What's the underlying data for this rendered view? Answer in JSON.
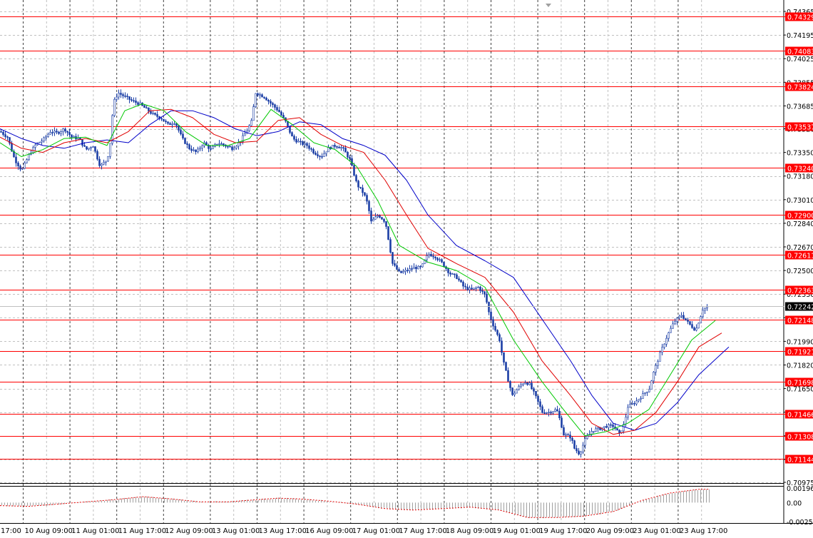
{
  "colors": {
    "background": "#ffffff",
    "grid": "#c0c0c0",
    "vgrid": "#000000",
    "level_line": "#ff0000",
    "level_box": "#ff0000",
    "level_text": "#ffffff",
    "candles": "#1c3fa6",
    "ma_fast": "#00c800",
    "ma_mid": "#e00000",
    "ma_slow": "#0000c8",
    "osc_bars": "#a0a0a0",
    "osc_line": "#e00000",
    "current_tag": "#000000",
    "axis_text": "#000000"
  },
  "chart_data": [
    {
      "type": "candlestick",
      "symbol_pair_precision": 5,
      "ylim": [
        0.70975,
        0.74365
      ],
      "y_ticks": [
        "0.74365",
        "0.74195",
        "0.74025",
        "0.73855",
        "0.73685",
        "0.73520",
        "0.73350",
        "0.73180",
        "0.73010",
        "0.72840",
        "0.72670",
        "0.72500",
        "0.72330",
        "0.72160",
        "0.71990",
        "0.71820",
        "0.71650",
        "0.71480",
        "0.71310",
        "0.71140",
        "0.70975"
      ],
      "x_labels": [
        "17:00",
        "10 Aug 09:00",
        "11 Aug 01:00",
        "11 Aug 17:00",
        "12 Aug 09:00",
        "13 Aug 01:00",
        "13 Aug 17:00",
        "16 Aug 09:00",
        "17 Aug 01:00",
        "17 Aug 17:00",
        "18 Aug 09:00",
        "19 Aug 01:00",
        "19 Aug 17:00",
        "20 Aug 09:00",
        "23 Aug 01:00",
        "23 Aug 17:00"
      ],
      "levels": [
        "0.74329",
        "0.74083",
        "0.73824",
        "0.73537",
        "0.73240",
        "0.72900",
        "0.72611",
        "0.72363",
        "0.72148",
        "0.71921",
        "0.71698",
        "0.71466",
        "0.71308",
        "0.71144"
      ],
      "current_price": "0.72242",
      "close_path": [
        [
          0,
          0.735
        ],
        [
          10,
          0.7346
        ],
        [
          20,
          0.733
        ],
        [
          30,
          0.7322
        ],
        [
          40,
          0.7333
        ],
        [
          50,
          0.7341
        ],
        [
          60,
          0.7344
        ],
        [
          70,
          0.735
        ],
        [
          80,
          0.7349
        ],
        [
          90,
          0.7352
        ],
        [
          100,
          0.7346
        ],
        [
          110,
          0.7345
        ],
        [
          120,
          0.7337
        ],
        [
          130,
          0.734
        ],
        [
          140,
          0.7325
        ],
        [
          150,
          0.733
        ],
        [
          155,
          0.7345
        ],
        [
          158,
          0.737
        ],
        [
          165,
          0.7378
        ],
        [
          175,
          0.7375
        ],
        [
          185,
          0.7372
        ],
        [
          195,
          0.737
        ],
        [
          205,
          0.7366
        ],
        [
          215,
          0.7362
        ],
        [
          225,
          0.736
        ],
        [
          235,
          0.7355
        ],
        [
          245,
          0.7357
        ],
        [
          255,
          0.7345
        ],
        [
          265,
          0.7338
        ],
        [
          275,
          0.7335
        ],
        [
          285,
          0.7342
        ],
        [
          295,
          0.7337
        ],
        [
          305,
          0.7342
        ],
        [
          315,
          0.734
        ],
        [
          325,
          0.7338
        ],
        [
          335,
          0.7342
        ],
        [
          345,
          0.735
        ],
        [
          352,
          0.7357
        ],
        [
          358,
          0.7378
        ],
        [
          370,
          0.7375
        ],
        [
          380,
          0.737
        ],
        [
          390,
          0.7365
        ],
        [
          400,
          0.7357
        ],
        [
          410,
          0.7345
        ],
        [
          420,
          0.7342
        ],
        [
          430,
          0.734
        ],
        [
          440,
          0.7335
        ],
        [
          450,
          0.7332
        ],
        [
          460,
          0.7338
        ],
        [
          470,
          0.734
        ],
        [
          480,
          0.7338
        ],
        [
          490,
          0.733
        ],
        [
          500,
          0.7312
        ],
        [
          510,
          0.7305
        ],
        [
          515,
          0.7298
        ],
        [
          520,
          0.7285
        ],
        [
          530,
          0.729
        ],
        [
          540,
          0.7285
        ],
        [
          545,
          0.727
        ],
        [
          550,
          0.7255
        ],
        [
          560,
          0.7248
        ],
        [
          570,
          0.725
        ],
        [
          580,
          0.7252
        ],
        [
          590,
          0.7252
        ],
        [
          600,
          0.7262
        ],
        [
          610,
          0.726
        ],
        [
          620,
          0.7255
        ],
        [
          630,
          0.7248
        ],
        [
          640,
          0.7245
        ],
        [
          650,
          0.7238
        ],
        [
          660,
          0.7236
        ],
        [
          670,
          0.7238
        ],
        [
          680,
          0.7232
        ],
        [
          685,
          0.722
        ],
        [
          690,
          0.7212
        ],
        [
          700,
          0.72
        ],
        [
          705,
          0.7185
        ],
        [
          710,
          0.7175
        ],
        [
          718,
          0.716
        ],
        [
          725,
          0.7165
        ],
        [
          735,
          0.717
        ],
        [
          742,
          0.7168
        ],
        [
          750,
          0.716
        ],
        [
          760,
          0.7148
        ],
        [
          770,
          0.7148
        ],
        [
          780,
          0.715
        ],
        [
          785,
          0.7142
        ],
        [
          790,
          0.7132
        ],
        [
          800,
          0.713
        ],
        [
          805,
          0.7122
        ],
        [
          812,
          0.7118
        ],
        [
          820,
          0.7128
        ],
        [
          830,
          0.7135
        ],
        [
          840,
          0.7136
        ],
        [
          850,
          0.7138
        ],
        [
          860,
          0.7138
        ],
        [
          868,
          0.7132
        ],
        [
          875,
          0.714
        ],
        [
          880,
          0.7152
        ],
        [
          890,
          0.7155
        ],
        [
          900,
          0.716
        ],
        [
          910,
          0.7165
        ],
        [
          915,
          0.7175
        ],
        [
          925,
          0.719
        ],
        [
          935,
          0.7203
        ],
        [
          945,
          0.7213
        ],
        [
          955,
          0.7218
        ],
        [
          965,
          0.7212
        ],
        [
          975,
          0.7207
        ],
        [
          985,
          0.7222
        ],
        [
          993,
          0.7224
        ]
      ],
      "ma_fast_path": [
        [
          0,
          0.7342
        ],
        [
          30,
          0.7332
        ],
        [
          60,
          0.7337
        ],
        [
          90,
          0.7345
        ],
        [
          120,
          0.7346
        ],
        [
          150,
          0.734
        ],
        [
          175,
          0.7365
        ],
        [
          200,
          0.737
        ],
        [
          230,
          0.7365
        ],
        [
          260,
          0.735
        ],
        [
          290,
          0.734
        ],
        [
          320,
          0.734
        ],
        [
          350,
          0.7345
        ],
        [
          380,
          0.7366
        ],
        [
          410,
          0.7355
        ],
        [
          440,
          0.7342
        ],
        [
          470,
          0.7337
        ],
        [
          500,
          0.7325
        ],
        [
          530,
          0.73
        ],
        [
          560,
          0.7268
        ],
        [
          600,
          0.7256
        ],
        [
          640,
          0.725
        ],
        [
          680,
          0.7238
        ],
        [
          720,
          0.72
        ],
        [
          760,
          0.717
        ],
        [
          790,
          0.715
        ],
        [
          820,
          0.7131
        ],
        [
          850,
          0.7134
        ],
        [
          880,
          0.714
        ],
        [
          910,
          0.715
        ],
        [
          940,
          0.7175
        ],
        [
          970,
          0.72
        ],
        [
          1003,
          0.7214
        ]
      ],
      "ma_mid_path": [
        [
          0,
          0.7346
        ],
        [
          30,
          0.7338
        ],
        [
          60,
          0.7335
        ],
        [
          90,
          0.7342
        ],
        [
          120,
          0.7345
        ],
        [
          150,
          0.7342
        ],
        [
          180,
          0.735
        ],
        [
          210,
          0.7365
        ],
        [
          240,
          0.7366
        ],
        [
          270,
          0.736
        ],
        [
          300,
          0.7348
        ],
        [
          330,
          0.7342
        ],
        [
          360,
          0.7343
        ],
        [
          390,
          0.7358
        ],
        [
          420,
          0.736
        ],
        [
          450,
          0.7348
        ],
        [
          480,
          0.734
        ],
        [
          510,
          0.7335
        ],
        [
          540,
          0.7315
        ],
        [
          570,
          0.729
        ],
        [
          600,
          0.7266
        ],
        [
          640,
          0.7255
        ],
        [
          680,
          0.7245
        ],
        [
          720,
          0.722
        ],
        [
          760,
          0.7185
        ],
        [
          800,
          0.716
        ],
        [
          830,
          0.714
        ],
        [
          860,
          0.7132
        ],
        [
          890,
          0.7135
        ],
        [
          920,
          0.7148
        ],
        [
          950,
          0.717
        ],
        [
          980,
          0.7195
        ],
        [
          1012,
          0.7205
        ]
      ],
      "ma_slow_path": [
        [
          0,
          0.7352
        ],
        [
          30,
          0.7345
        ],
        [
          60,
          0.734
        ],
        [
          90,
          0.7338
        ],
        [
          120,
          0.7342
        ],
        [
          150,
          0.7344
        ],
        [
          180,
          0.7342
        ],
        [
          210,
          0.7355
        ],
        [
          240,
          0.7365
        ],
        [
          270,
          0.7365
        ],
        [
          300,
          0.736
        ],
        [
          330,
          0.7352
        ],
        [
          360,
          0.7347
        ],
        [
          390,
          0.735
        ],
        [
          420,
          0.7357
        ],
        [
          450,
          0.7355
        ],
        [
          480,
          0.7345
        ],
        [
          510,
          0.734
        ],
        [
          540,
          0.7333
        ],
        [
          570,
          0.7315
        ],
        [
          600,
          0.729
        ],
        [
          640,
          0.7268
        ],
        [
          680,
          0.7257
        ],
        [
          720,
          0.7245
        ],
        [
          760,
          0.7215
        ],
        [
          800,
          0.7185
        ],
        [
          830,
          0.716
        ],
        [
          860,
          0.714
        ],
        [
          890,
          0.7135
        ],
        [
          920,
          0.714
        ],
        [
          950,
          0.7155
        ],
        [
          980,
          0.7175
        ],
        [
          1022,
          0.7195
        ]
      ]
    },
    {
      "type": "oscillator",
      "ylim": [
        -0.00255,
        0.00196
      ],
      "y_ticks": [
        "0.001961",
        "0.00",
        "-0.00255"
      ],
      "signal_path": [
        [
          0,
          -0.0004
        ],
        [
          40,
          -0.0005
        ],
        [
          80,
          -0.0002
        ],
        [
          120,
          0.0001
        ],
        [
          160,
          0.0004
        ],
        [
          200,
          0.0008
        ],
        [
          240,
          0.0005
        ],
        [
          280,
          0.0001
        ],
        [
          320,
          0.0001
        ],
        [
          360,
          0.0004
        ],
        [
          390,
          0.0006
        ],
        [
          420,
          0.0005
        ],
        [
          460,
          0.0002
        ],
        [
          500,
          -0.0002
        ],
        [
          540,
          -0.0008
        ],
        [
          580,
          -0.001
        ],
        [
          620,
          -0.0008
        ],
        [
          660,
          -0.0006
        ],
        [
          700,
          -0.001
        ],
        [
          740,
          -0.002
        ],
        [
          780,
          -0.002
        ],
        [
          820,
          -0.0018
        ],
        [
          860,
          -0.0012
        ],
        [
          900,
          0.0003
        ],
        [
          940,
          0.0013
        ],
        [
          980,
          0.0018
        ],
        [
          995,
          0.0018
        ]
      ]
    }
  ]
}
